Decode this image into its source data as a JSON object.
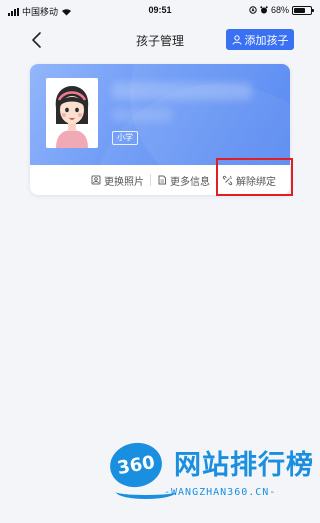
{
  "status_bar": {
    "carrier": "中国移动",
    "time": "09:51",
    "battery_percent": "68%",
    "battery_level": 0.68,
    "icons": [
      "signal-icon",
      "wifi-icon",
      "location-icon",
      "alarm-icon",
      "battery-icon"
    ]
  },
  "navbar": {
    "title": "孩子管理",
    "back_icon": "chevron-left-icon",
    "add_button_label": "添加孩子",
    "add_button_icon": "user-icon"
  },
  "child_card": {
    "avatar_icon": "girl-avatar",
    "grade_tag": "小学",
    "actions": [
      {
        "label": "更换照片",
        "icon": "photo-icon"
      },
      {
        "label": "更多信息",
        "icon": "document-icon"
      },
      {
        "label": "解除绑定",
        "icon": "unlink-icon"
      }
    ]
  },
  "watermark": {
    "logo_text": "360",
    "title": "网站排行榜",
    "subtitle": "-WANGZHAN360.CN-"
  },
  "colors": {
    "accent": "#3a70f2",
    "card_gradient_start": "#93b6fb",
    "card_gradient_end": "#4f84f2",
    "highlight": "#e02020",
    "watermark": "#1a8fe0",
    "background": "#f4f5f9"
  }
}
